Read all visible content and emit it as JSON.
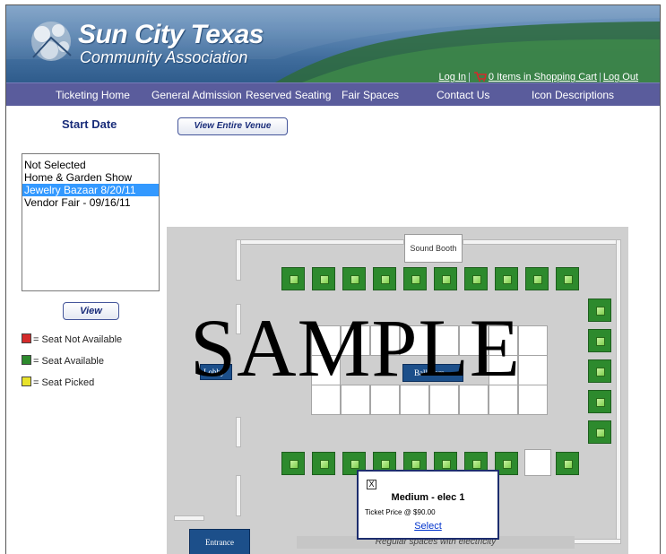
{
  "header": {
    "title": "Sun City Texas",
    "subtitle": "Community Association",
    "login_label": "Log In",
    "cart_label": "0 Items in Shopping Cart",
    "logout_label": "Log Out"
  },
  "nav": {
    "items": [
      {
        "label": "Ticketing Home"
      },
      {
        "label": "General Admission"
      },
      {
        "label": "Reserved Seating"
      },
      {
        "label": "Fair Spaces"
      },
      {
        "label": "Contact Us"
      },
      {
        "label": "Icon Descriptions"
      }
    ]
  },
  "left_panel": {
    "start_date_heading": "Start Date",
    "dates": [
      {
        "label": "Not Selected"
      },
      {
        "label": "Home & Garden Show"
      },
      {
        "label": "Jewelry Bazaar 8/20/11",
        "selected": true
      },
      {
        "label": "Vendor Fair - 09/16/11"
      }
    ],
    "view_button": "View",
    "legend": [
      {
        "label": "= Seat Not Available",
        "color": "#d42a2a"
      },
      {
        "label": "= Seat Available",
        "color": "#2d8a2d"
      },
      {
        "label": "= Seat Picked",
        "color": "#e8e22a"
      }
    ]
  },
  "venue": {
    "view_entire_venue": "View Entire Venue",
    "sound_booth": "Sound Booth",
    "lobby": "Lobby",
    "ballroom": "Ballroom",
    "entrance": "Entrance",
    "regular_spaces": "Regular spaces with electricity"
  },
  "watermark": "SAMPLE",
  "popup": {
    "close_glyph": "X",
    "title": "Medium - elec 1",
    "price": "Ticket Price @ $90.00",
    "select_label": "Select"
  },
  "colors": {
    "nav_bg": "#5a5c9c",
    "seat_available": "#2d8a2d",
    "selected_date_bg": "#3399ff",
    "link_blue": "#0033cc"
  }
}
